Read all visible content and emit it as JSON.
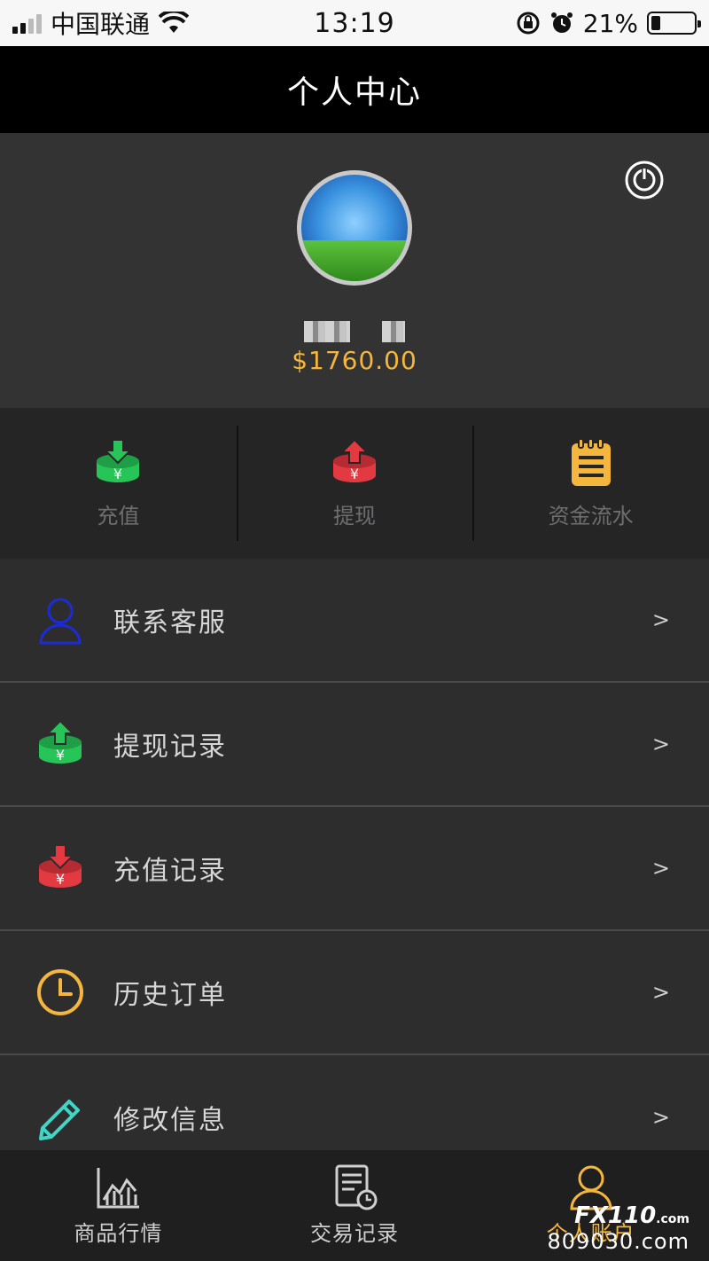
{
  "status_bar": {
    "carrier": "中国联通",
    "time": "13:19",
    "battery": "21%",
    "battery_level": 0.21
  },
  "header": {
    "title": "个人中心"
  },
  "profile": {
    "balance": "$1760.00"
  },
  "actions": [
    {
      "label": "充值",
      "icon": "deposit-icon",
      "color": "#27c458"
    },
    {
      "label": "提现",
      "icon": "withdraw-icon",
      "color": "#e33a42"
    },
    {
      "label": "资金流水",
      "icon": "notepad-icon",
      "color": "#f4b63d"
    }
  ],
  "menu": [
    {
      "label": "联系客服",
      "icon": "user-icon",
      "arrow": ">"
    },
    {
      "label": "提现记录",
      "icon": "withdraw-icon",
      "arrow": ">"
    },
    {
      "label": "充值记录",
      "icon": "deposit-icon",
      "arrow": ">"
    },
    {
      "label": "历史订单",
      "icon": "clock-icon",
      "arrow": ">"
    },
    {
      "label": "修改信息",
      "icon": "pencil-icon",
      "arrow": ">"
    }
  ],
  "tabbar": [
    {
      "label": "商品行情",
      "icon": "chart-icon",
      "active": false
    },
    {
      "label": "交易记录",
      "icon": "document-clock-icon",
      "active": false
    },
    {
      "label": "个人账户",
      "icon": "person-icon",
      "active": true
    }
  ],
  "watermark": {
    "logo": "FX110",
    "logo_suffix": ".com",
    "domain": "809030.com"
  },
  "colors": {
    "accent": "#f4b63d",
    "green": "#27c458",
    "red": "#e33a42",
    "blue": "#1d2bd6",
    "cyan": "#3fd6c8"
  }
}
